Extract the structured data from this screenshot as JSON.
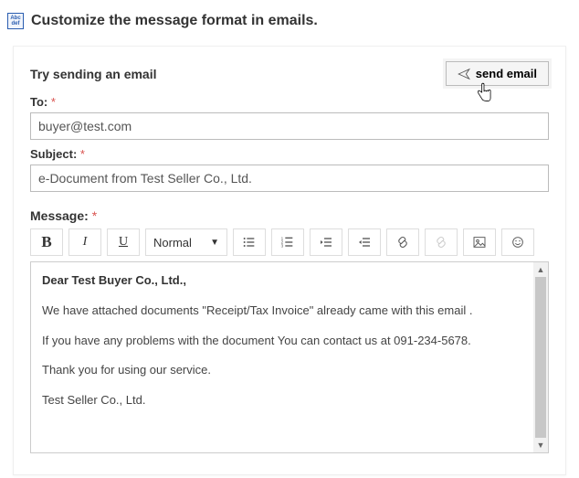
{
  "header": {
    "icon_top": "Abc",
    "icon_bottom": "def",
    "title": "Customize the message format in emails."
  },
  "card": {
    "try_label": "Try sending an email",
    "send_button": "send email"
  },
  "fields": {
    "to_label": "To:",
    "to_value": "buyer@test.com",
    "subject_label": "Subject:",
    "subject_value": "e-Document from Test Seller Co., Ltd.",
    "message_label": "Message:",
    "required_mark": "*"
  },
  "toolbar": {
    "bold": "B",
    "italic": "I",
    "underline": "U",
    "format_select": "Normal"
  },
  "message_body": {
    "greeting": "Dear Test Buyer Co., Ltd.,",
    "line1": "We have attached documents \"Receipt/Tax Invoice\" already came with this email .",
    "line2": "If you have any problems with the document You can contact us at 091-234-5678.",
    "line3": "Thank you for using our service.",
    "sign": "Test Seller Co., Ltd."
  }
}
